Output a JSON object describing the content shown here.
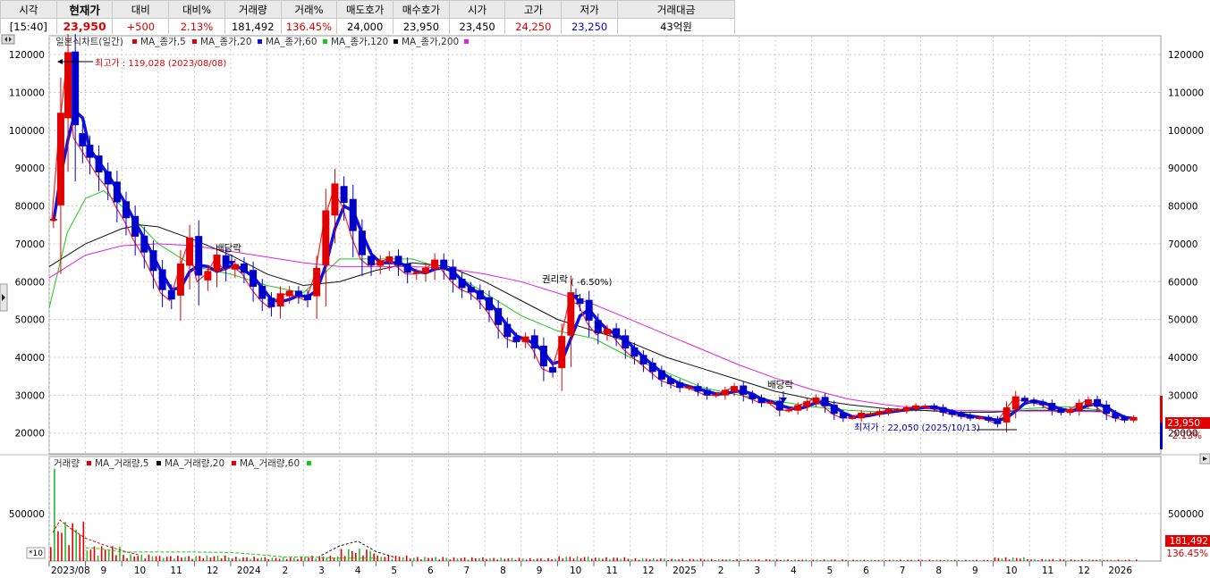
{
  "quote_table": {
    "headers": [
      "시각",
      "현재가",
      "대비",
      "대비%",
      "거래량",
      "거래%",
      "매도호가",
      "매수호가",
      "시가",
      "고가",
      "저가",
      "거래대금"
    ],
    "values": [
      "[15:40]",
      "23,950",
      "+500",
      "2.13%",
      "181,492",
      "136.45%",
      "24,000",
      "23,950",
      "23,450",
      "24,250",
      "23,250",
      "43억원"
    ]
  },
  "price_legend": {
    "title": "일본식차트(일간)",
    "ma": [
      "MA_종가,5",
      "MA_종가,20",
      "MA_종가,60",
      "MA_종가,120",
      "MA_종가,200"
    ]
  },
  "volume_legend": {
    "title": "거래량",
    "ma": [
      "MA_거래량,5",
      "MA_거래량,20",
      "MA_거래량,60"
    ]
  },
  "annotations": {
    "high": "최고가 : 119,028 (2023/08/08)",
    "low": "최저가 : 22,050 (2025/10/13)",
    "div1": "배당락",
    "rights": "권리락",
    "rights_pct": "( -6.50%)",
    "div2": "배당락"
  },
  "right_labels": {
    "price": "23,950",
    "change": "2.13%",
    "volume": "181,492",
    "volume_pct": "136.45%"
  },
  "scale_factor": "*10",
  "colors": {
    "up": "#e00000",
    "down": "#0000cc",
    "ma5": "#ff2020",
    "ma20": "#1010e0",
    "ma60": "#19c819",
    "ma120": "#101010",
    "ma200": "#e020e0"
  },
  "chart_data": [
    {
      "type": "candlestick",
      "title": "일본식차트(일간)",
      "y_ticks": [
        20000,
        30000,
        40000,
        50000,
        60000,
        70000,
        80000,
        90000,
        100000,
        110000,
        120000
      ],
      "ylim": [
        14500,
        125000
      ],
      "x_labels": [
        "2023/08",
        "9",
        "10",
        "11",
        "12",
        "2024",
        "2",
        "3",
        "4",
        "5",
        "6",
        "7",
        "8",
        "9",
        "10",
        "11",
        "12",
        "2025",
        "2",
        "3",
        "4",
        "5",
        "6",
        "7",
        "8",
        "9",
        "10",
        "11",
        "12",
        "2026"
      ],
      "close_monthly": [
        {
          "m": "2023/08",
          "v": [
            76000,
            100000,
            117000,
            98000,
            95000
          ]
        },
        {
          "m": "2023-09",
          "v": [
            92000,
            88000,
            85000,
            80000
          ]
        },
        {
          "m": "2023-10",
          "v": [
            76000,
            71000,
            67000,
            62000
          ]
        },
        {
          "m": "2023-11",
          "v": [
            57000,
            55000,
            63000,
            70000
          ]
        },
        {
          "m": "2023-12",
          "v": [
            60000,
            62000,
            66000,
            63000
          ]
        },
        {
          "m": "2024-01",
          "v": [
            64000,
            62000,
            58000,
            55000
          ]
        },
        {
          "m": "2024-02",
          "v": [
            53000,
            56000,
            57000,
            56000
          ]
        },
        {
          "m": "2024-03",
          "v": [
            55000,
            62000,
            76000,
            84000
          ]
        },
        {
          "m": "2024-04",
          "v": [
            80000,
            72000,
            66000,
            64000
          ]
        },
        {
          "m": "2024-05",
          "v": [
            65000,
            66000,
            64000,
            62000
          ]
        },
        {
          "m": "2024-06",
          "v": [
            62000,
            63000,
            65000,
            63000
          ]
        },
        {
          "m": "2024-07",
          "v": [
            60000,
            58000,
            57000,
            55000
          ]
        },
        {
          "m": "2024-08",
          "v": [
            52000,
            48000,
            45000,
            44000
          ]
        },
        {
          "m": "2024-09",
          "v": [
            45000,
            42000,
            37000,
            36000
          ]
        },
        {
          "m": "2024-10",
          "v": [
            44000,
            55000,
            54000,
            49000
          ]
        },
        {
          "m": "2024-11",
          "v": [
            46000,
            47000,
            45000,
            42000
          ]
        },
        {
          "m": "2024-12",
          "v": [
            40000,
            38000,
            36000,
            34000
          ]
        },
        {
          "m": "2025-01",
          "v": [
            33000,
            32000,
            32000,
            31000
          ]
        },
        {
          "m": "2025-02",
          "v": [
            30000,
            30000,
            31000,
            32000
          ]
        },
        {
          "m": "2025-03",
          "v": [
            30000,
            29000,
            28000,
            28000
          ]
        },
        {
          "m": "2025-04",
          "v": [
            26000,
            26000,
            27000,
            28000
          ]
        },
        {
          "m": "2025-05",
          "v": [
            29000,
            27000,
            25000,
            24000
          ]
        },
        {
          "m": "2025-06",
          "v": [
            24000,
            25000,
            25000,
            25500
          ]
        },
        {
          "m": "2025-07",
          "v": [
            26000,
            26000,
            26500,
            27000
          ]
        },
        {
          "m": "2025-08",
          "v": [
            27000,
            26500,
            25500,
            25000
          ]
        },
        {
          "m": "2025-09",
          "v": [
            24500,
            24000,
            24000,
            23500
          ]
        },
        {
          "m": "2025-10",
          "v": [
            22500,
            26000,
            29000,
            28500
          ]
        },
        {
          "m": "2025-11",
          "v": [
            28000,
            27500,
            26000,
            25500
          ]
        },
        {
          "m": "2025-12",
          "v": [
            26000,
            27500,
            28500,
            27000
          ]
        },
        {
          "m": "2026-01",
          "v": [
            25000,
            24000,
            23500,
            23950
          ]
        }
      ],
      "ma": [
        {
          "name": "MA_종가,60",
          "points": [
            [
              0.0,
              53000
            ],
            [
              0.5,
              73000
            ],
            [
              1.0,
              82000
            ],
            [
              1.5,
              84000
            ],
            [
              2.0,
              80000
            ],
            [
              3.0,
              70000
            ],
            [
              4.0,
              64000
            ],
            [
              5.0,
              62000
            ],
            [
              6.0,
              59000
            ],
            [
              7.0,
              57000
            ],
            [
              8.0,
              66000
            ],
            [
              9.0,
              66000
            ],
            [
              10.0,
              66000
            ],
            [
              11.0,
              63000
            ],
            [
              12.0,
              57000
            ],
            [
              13.0,
              51000
            ],
            [
              14.0,
              47000
            ],
            [
              15.0,
              45000
            ],
            [
              16.0,
              40000
            ],
            [
              17.0,
              36000
            ],
            [
              18.0,
              32000
            ],
            [
              19.0,
              30000
            ],
            [
              20.0,
              28500
            ],
            [
              21.0,
              27000
            ],
            [
              22.0,
              26000
            ],
            [
              23.0,
              25500
            ],
            [
              24.0,
              26000
            ],
            [
              25.0,
              25500
            ],
            [
              26.0,
              25500
            ],
            [
              27.0,
              26500
            ],
            [
              28.0,
              27000
            ],
            [
              29.0,
              26000
            ]
          ]
        },
        {
          "name": "MA_종가,120",
          "points": [
            [
              0.0,
              64000
            ],
            [
              1.0,
              70000
            ],
            [
              2.0,
              74000
            ],
            [
              2.5,
              75000
            ],
            [
              3.0,
              74500
            ],
            [
              4.0,
              71000
            ],
            [
              5.0,
              67000
            ],
            [
              6.0,
              62000
            ],
            [
              7.0,
              59000
            ],
            [
              8.0,
              60000
            ],
            [
              9.0,
              63000
            ],
            [
              10.0,
              65000
            ],
            [
              11.0,
              64000
            ],
            [
              12.0,
              60000
            ],
            [
              13.0,
              55000
            ],
            [
              14.0,
              50000
            ],
            [
              15.0,
              47000
            ],
            [
              16.0,
              44000
            ],
            [
              17.0,
              40000
            ],
            [
              18.0,
              37000
            ],
            [
              19.0,
              34000
            ],
            [
              20.0,
              31000
            ],
            [
              21.0,
              29000
            ],
            [
              22.0,
              27500
            ],
            [
              23.0,
              26500
            ],
            [
              24.0,
              26000
            ],
            [
              25.0,
              25500
            ],
            [
              26.0,
              25500
            ],
            [
              27.0,
              26000
            ],
            [
              28.0,
              26000
            ],
            [
              29.0,
              25800
            ]
          ]
        },
        {
          "name": "MA_종가,200",
          "points": [
            [
              0.0,
              61000
            ],
            [
              1.0,
              67000
            ],
            [
              2.0,
              69500
            ],
            [
              3.0,
              70000
            ],
            [
              4.0,
              69500
            ],
            [
              5.0,
              68000
            ],
            [
              6.0,
              66500
            ],
            [
              7.0,
              65000
            ],
            [
              8.0,
              64000
            ],
            [
              9.0,
              64000
            ],
            [
              10.0,
              64000
            ],
            [
              11.0,
              63500
            ],
            [
              12.0,
              62000
            ],
            [
              13.0,
              60000
            ],
            [
              14.0,
              57000
            ],
            [
              15.0,
              54000
            ],
            [
              16.0,
              50000
            ],
            [
              17.0,
              46000
            ],
            [
              18.0,
              42000
            ],
            [
              19.0,
              38000
            ],
            [
              20.0,
              34500
            ],
            [
              21.0,
              31500
            ],
            [
              22.0,
              29000
            ],
            [
              23.0,
              27500
            ],
            [
              24.0,
              26500
            ],
            [
              25.0,
              26000
            ],
            [
              26.0,
              25800
            ],
            [
              27.0,
              25800
            ],
            [
              28.0,
              25800
            ],
            [
              29.0,
              25600
            ]
          ]
        }
      ]
    },
    {
      "type": "bar",
      "title": "거래량",
      "y_ticks": [
        500000
      ],
      "ylim": [
        0,
        1100000
      ],
      "monthly_volume": [
        420000,
        160000,
        70000,
        55000,
        60000,
        45000,
        40000,
        55000,
        130000,
        60000,
        45000,
        40000,
        35000,
        30000,
        50000,
        40000,
        30000,
        25000,
        22000,
        20000,
        18000,
        18000,
        15000,
        15000,
        15000,
        14000,
        40000,
        22000,
        18000,
        16000
      ],
      "ma_lines": [
        {
          "name": "MA_거래량,20",
          "points": [
            [
              0.1,
              300000
            ],
            [
              0.3,
              430000
            ],
            [
              0.6,
              340000
            ],
            [
              1.0,
              240000
            ],
            [
              1.5,
              170000
            ],
            [
              2.0,
              110000
            ],
            [
              2.5,
              60000
            ]
          ]
        },
        {
          "name": "MA_거래량,60",
          "points": [
            [
              1.0,
              140000
            ],
            [
              1.4,
              130000
            ],
            [
              2.0,
              95000
            ],
            [
              3.0,
              95000
            ],
            [
              4.0,
              95000
            ],
            [
              5.0,
              90000
            ],
            [
              6.0,
              60000
            ],
            [
              6.5,
              40000
            ],
            [
              7.0,
              45000
            ],
            [
              8.0,
              30000
            ],
            [
              9.0,
              30000
            ]
          ]
        },
        {
          "name": "MA_거래량,20",
          "points": [
            [
              7.5,
              60000
            ],
            [
              8.0,
              160000
            ],
            [
              8.5,
              210000
            ],
            [
              9.0,
              100000
            ],
            [
              9.5,
              40000
            ]
          ]
        }
      ]
    }
  ]
}
